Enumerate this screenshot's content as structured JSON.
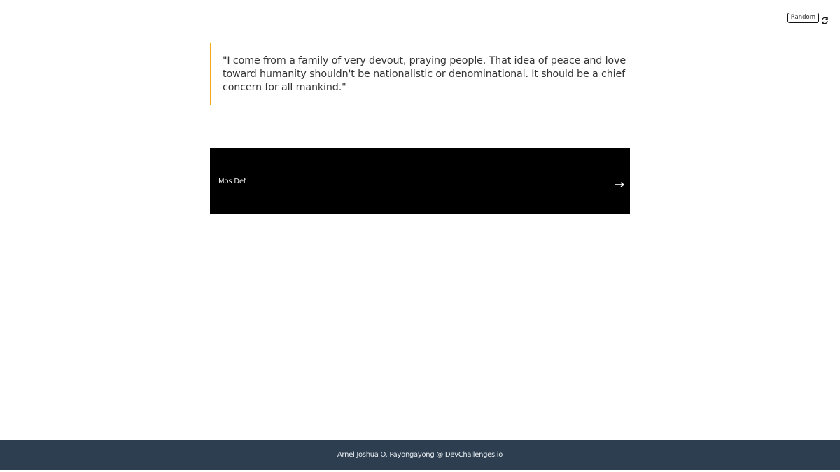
{
  "toolbar": {
    "random_label": "Random",
    "refresh_icon": "refresh-icon"
  },
  "quote": {
    "text": "\"I come from a family of very devout, praying people. That idea of peace and love toward humanity shouldn't be nationalistic or denominational. It should be a chief concern for all mankind.\"",
    "accent_color": "#f7a81b"
  },
  "author": {
    "name": "Mos Def",
    "arrow_icon": "arrow-right-icon",
    "background": "#000000"
  },
  "footer": {
    "text": "Arnel Joshua O. Payongayong @ DevChallenges.io",
    "background": "#2c3e50"
  }
}
